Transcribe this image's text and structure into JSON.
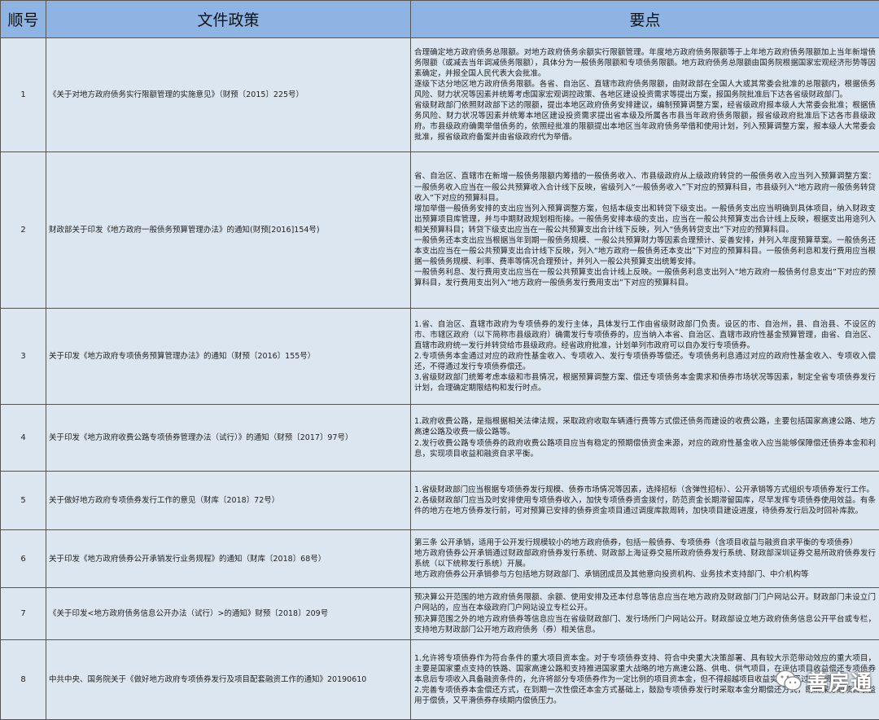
{
  "header": {
    "col1": "顺号",
    "col2": "文件政策",
    "col3": "要点"
  },
  "rows": [
    {
      "num": "1",
      "policy": "《关于对地方政府债务实行限额管理的实施意见》（财预〔2015〕225号）",
      "points": [
        "合理确定地方政府债务总限额。对地方政府债务余额实行限额管理。年度地方政府债务限额等于上年地方政府债务限额加上当年新增债务限额（或减去当年调减债务限额），具体分为一般债务限额和专项债务限额。地方政府债务总限额由国务院根据国家宏观经济形势等因素确定，并报全国人民代表大会批准。",
        "逐级下达分地区地方政府债务限额。各省、自治区、直辖市政府债务限额，由财政部在全国人大或其常委会批准的总限额内，根据债务风险、财力状况等因素并统筹考虑国家宏观调控政策、各地区建设投资需求等提出方案，报国务院批准后下达各省级财政部门。",
        "省级财政部门依照财政部下达的限额，提出本地区政府债务安排建议，编制预算调整方案，经省级政府报本级人大常委会批准；根据债务风险、财力状况等因素并统筹本地区建设投资需求提出省本级及所属各市县当年政府债务限额，报省级政府批准后下达各市县级政府。市县级政府确需举借债务的，依照经批准的限额提出本地区当年政府债务举借和使用计划，列入预算调整方案，报本级人大常委会批准，报省级政府备案并由省级政府代为举借。"
      ]
    },
    {
      "num": "2",
      "policy": "财政部关于印发《地方政府一般债务预算管理办法》的通知(财预[2016]154号)",
      "points": [
        "省、自治区、直辖市在新增一般债务限额内筹措的一般债务收入、市县级政府从上级政府转贷的一般债务收入应当列入预算调整方案：一般债务收入应当在一般公共预算收入合计线下反映，省级列入“一般债务收入”下对应的预算科目，市县级列入“地方政府一般债务转贷收入”下对应的预算科目。",
        "增加举借一般债务安排的支出应当列入预算调整方案，包括本级支出和转贷下级支出。一般债务支出应当明确到具体项目，纳入财政支出预算项目库管理，并与中期财政规划相衔接。一般债务安排本级的支出，应当在一般公共预算支出合计线上反映，根据支出用途列入相关预算科目；转贷下级支出应当在一般公共预算支出合计线下反映，列入“债务转贷支出”下对应的预算科目。",
        "一般债务还本支出应当根据当年到期一般债务规模、一般公共预算财力等因素合理预计、妥善安排，并列入年度预算草案。一般债务还本支出应当在一般公共预算支出合计线下反映，列入“地方政府一般债务还本支出”下对应的预算科目。一般债务利息和发行费用应当根据一般债务规模、利率、费率等情况合理预计，并列入一般公共预算支出统筹安排。",
        "一般债务利息、发行费用支出应当在一般公共预算支出合计线上反映。一般债务利息支出列入“地方政府一般债务付息支出”下对应的预算科目，发行费用支出列入“地方政府一般债务发行费用支出”下对应的预算科目。"
      ]
    },
    {
      "num": "3",
      "policy": "关于印发《地方政府专项债务预算管理办法》的通知（财预〔2016〕155号）",
      "points": [
        "1.省、自治区、直辖市政府为专项债券的发行主体，具体发行工作由省级财政部门负责。设区的市、自治州，县、自治县、不设区的市、市辖区政府（以下简称市县级政府）确需发行专项债券的，应当纳入本省、自治区、直辖市政府性基金预算管理，由省、自治区、直辖市政府统一发行并转贷给市县级政府。经省政府批准，计划单列市政府可以自办发行专项债券。",
        "2.专项债务本金通过对应的政府性基金收入、专项收入、发行专项债券等偿还。专项债务利息通过对应的政府性基金收入、专项收入偿还，不得通过发行专项债券偿还。",
        "3.省级财政部门统筹考虑本级和市县情况，根据预算调整方案、偿还专项债务本金需求和债券市场状况等因素，制定全省专项债券发行计划，合理确定期限结构和发行时点。"
      ]
    },
    {
      "num": "4",
      "policy": "关于印发《地方政府收费公路专项债券管理办法（试行）》的通知（财预〔2017〕97号）",
      "points": [
        "1.政府收费公路，是指根据相关法律法规，采取政府收取车辆通行费等方式偿还债务而建设的收费公路，主要包括国家高速公路、地方高速公路及收费一级公路等。",
        "2.发行收费公路专项债券的政府收费公路项目应当有稳定的预期偿债资金来源，对应的政府性基金收入应当能够保障偿还债券本金和利息，实现项目收益和融资自求平衡。"
      ]
    },
    {
      "num": "5",
      "policy": "关于做好地方政府专项债券发行工作的意见（财库〔2018〕72号）",
      "points": [
        "1.省级财政部门应当根据专项债券发行规模、债券市场情况等因素，选择招标（含弹性招标）、公开承销等方式组织专项债券发行工作。",
        "2.各级财政部门应当及时安排使用专项债券收入，加快专项债券资金拨付，防范资金长期滞留国库，尽早发挥专项债券使用效益。有条件的地方在地方债券发行前，可对预算已安排的债券资金项目通过调度库款周转，加快项目建设进度，待债券发行后及时回补库款。"
      ]
    },
    {
      "num": "6",
      "policy": "关于印发《地方政府债券公开承销发行业务规程》的通知（财库〔2018〕68号）",
      "points": [
        "第三条 公开承销，适用于公开发行规模较小的地方政府债券，包括一般债券、专项债券（含项目收益与融资自求平衡的专项债券）",
        "地方政府债券公开承销通过财政部政府债券发行系统、财政部上海证券交易所政府债券发行系统、财政部深圳证券交易所政府债券发行系统（以下统称发行系统）开展。",
        "地方政府债券公开承销参与方包括地方财政部门、承销团成员及其他意向投资机构、业务技术支持部门、中介机构等"
      ]
    },
    {
      "num": "7",
      "policy": "《关于印发<地方政府债务信息公开办法（试行）>的通知》财预〔2018〕209号",
      "points": [
        "预决算公开范围的地方政府债务限额、余额、使用安排及还本付息等信息应当在地方政府及财政部门门户网站公开。财政部门未设立门户网站的，应当在本级政府门户网站设立专栏公开。",
        "预决算范围之外的地方政府债券等信息应当在省级财政部门、发行场所门户网站公开。财政部设立地方政府债务信息公开平台或专栏，支持地方财政部门公开地方政府债务（券）相关信息。"
      ]
    },
    {
      "num": "8",
      "policy": "中共中央、国务院关于《做好地方政府专项债券发行及项目配套融资工作的通知》20190610",
      "points": [
        "1.允许将专项债券作为符合条件的重大项目资本金。对于专项债券支持、符合中央重大决策部署、具有较大示范带动效应的重大项目，主要是国家重点支持的铁路、国家高速公路和支持推进国家重大战略的地方高速公路、供电、供气项目，在评估项目收益偿还专项债券本息后专项收入具备融资条件的，允许将部分专项债券作为一定比例的项目资本金，但不得超越项目收益实际水平过度融资。",
        "2.完善专项债券本金偿还方式，在到期一次性偿还本金方式基础上，鼓励专项债券发行时采取本金分期偿还方式，既确保分期项目收益用于偿债，又平滑债券存续期内偿债压力。"
      ]
    }
  ],
  "watermark": {
    "text": "善房通",
    "icon": "wechat-logo-icon"
  }
}
